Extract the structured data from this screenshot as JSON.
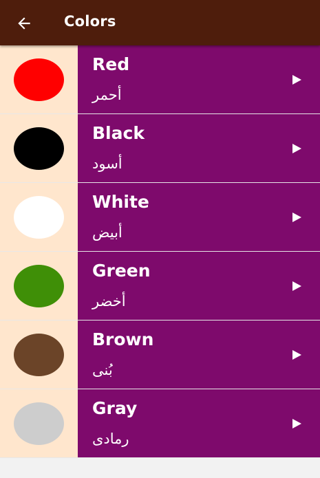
{
  "app_bar": {
    "title": "Colors",
    "back_icon": "arrow-left-icon",
    "background": "#4e1d0c"
  },
  "list": {
    "swatch_background": "#ffe6cd",
    "row_background": "#7e0a6c",
    "play_icon": "play-triangle-icon",
    "items": [
      {
        "name": "Red",
        "arabic": "أحمر",
        "color": "#ff0000"
      },
      {
        "name": "Black",
        "arabic": "أسود",
        "color": "#000000"
      },
      {
        "name": "White",
        "arabic": "أبيض",
        "color": "#ffffff"
      },
      {
        "name": "Green",
        "arabic": "أخضر",
        "color": "#3f8f07"
      },
      {
        "name": "Brown",
        "arabic": "بُنى",
        "color": "#6b4428"
      },
      {
        "name": "Gray",
        "arabic": "رمادى",
        "color": "#cdcdcd"
      }
    ]
  }
}
